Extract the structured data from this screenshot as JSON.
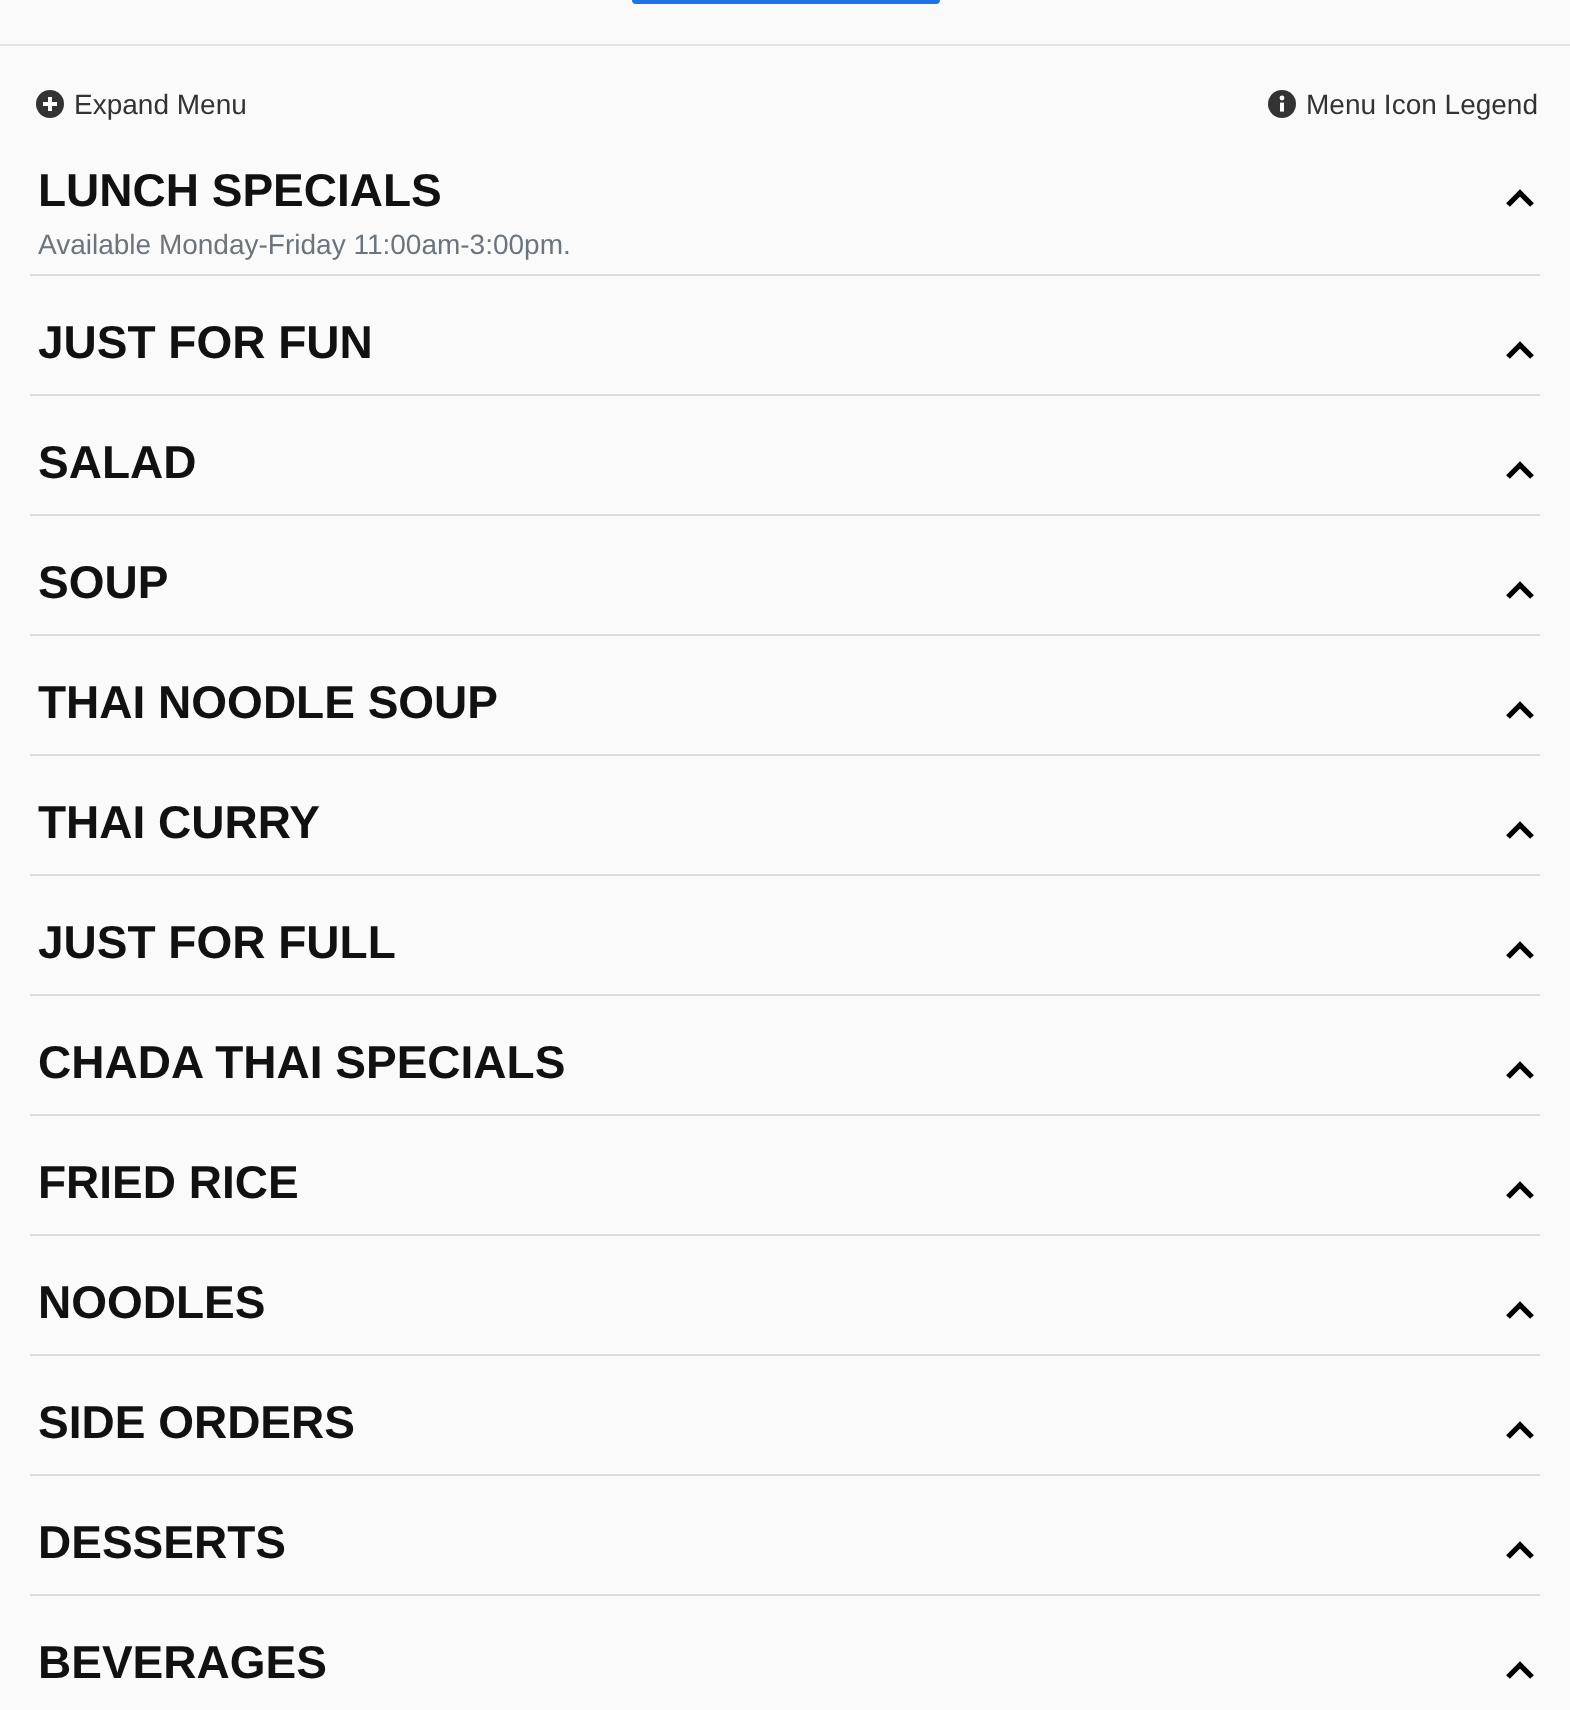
{
  "toolbar": {
    "expand_label": "Expand Menu",
    "legend_label": "Menu Icon Legend"
  },
  "sections": [
    {
      "title": "LUNCH SPECIALS",
      "note": "Available Monday-Friday 11:00am-3:00pm."
    },
    {
      "title": "JUST FOR FUN"
    },
    {
      "title": "SALAD"
    },
    {
      "title": "SOUP"
    },
    {
      "title": "THAI NOODLE SOUP"
    },
    {
      "title": "THAI CURRY"
    },
    {
      "title": "JUST FOR FULL"
    },
    {
      "title": "CHADA THAI SPECIALS"
    },
    {
      "title": "FRIED RICE"
    },
    {
      "title": "NOODLES"
    },
    {
      "title": "SIDE ORDERS"
    },
    {
      "title": "DESSERTS"
    },
    {
      "title": "BEVERAGES"
    }
  ]
}
